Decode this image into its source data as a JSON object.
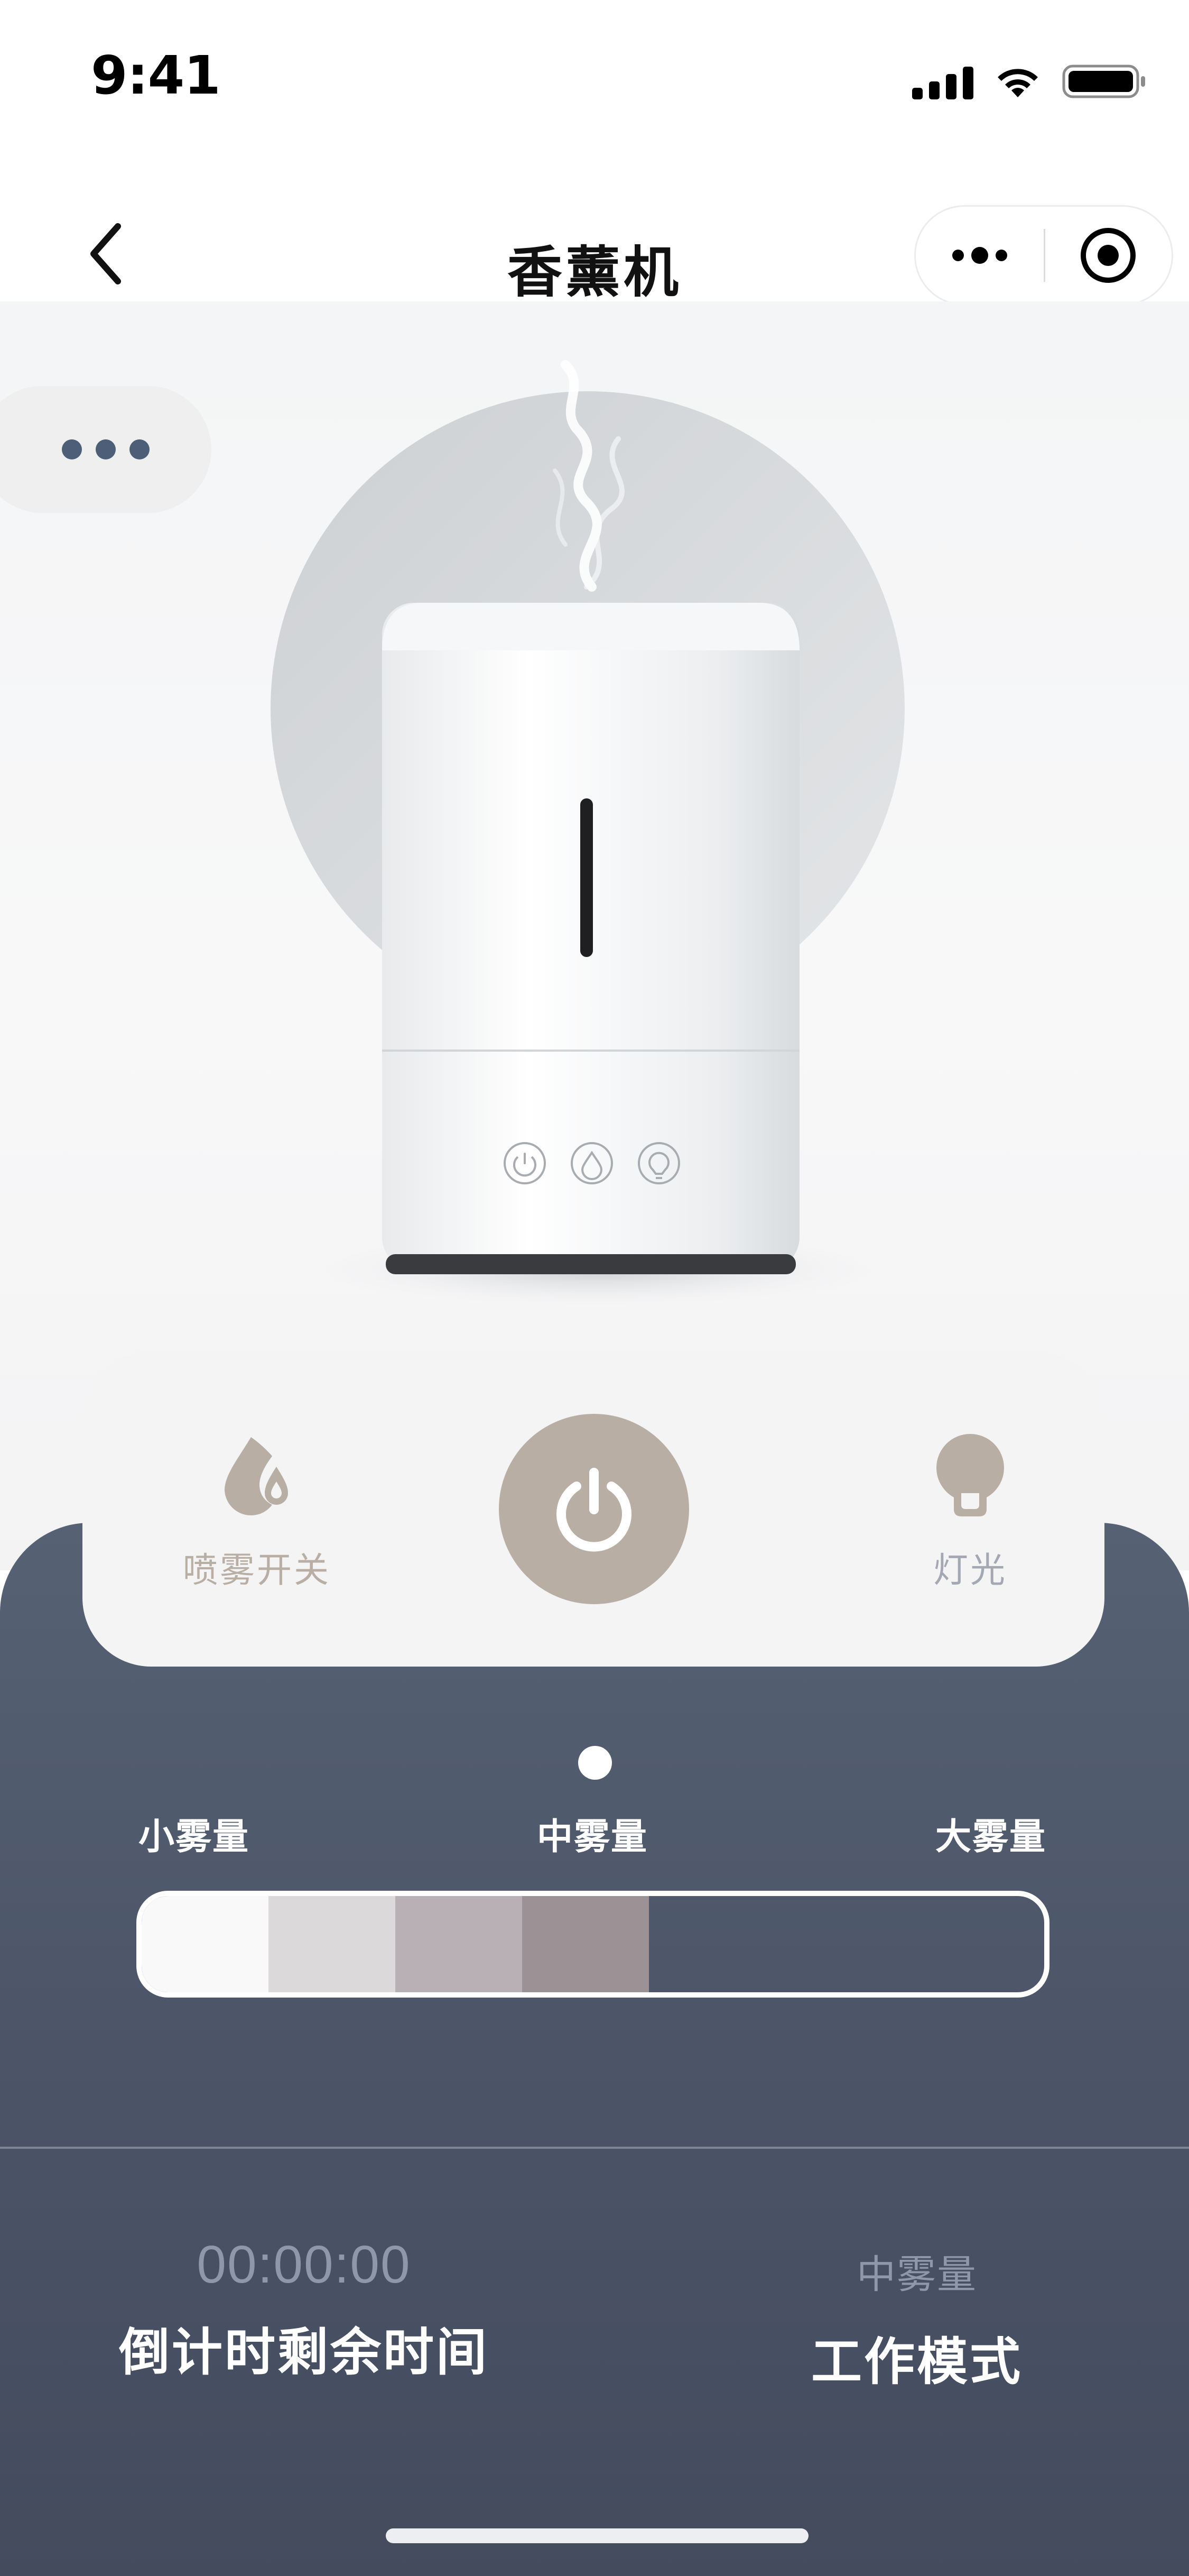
{
  "status_bar": {
    "time": "9:41",
    "icons": [
      "signal-icon",
      "wifi-icon",
      "battery-icon"
    ]
  },
  "nav": {
    "title": "香薰机",
    "back_icon": "chevron-left-icon",
    "capsule_icons": [
      "more-icon",
      "close-target-icon"
    ]
  },
  "hero": {
    "more_icon": "more-dots-icon",
    "device_buttons": [
      "power-icon",
      "drop-icon",
      "bulb-icon"
    ]
  },
  "controls": {
    "spray_label": "喷雾开关",
    "light_label": "灯光",
    "power_icon": "power-icon"
  },
  "mist": {
    "levels": [
      "小雾量",
      "中雾量",
      "大雾量"
    ],
    "current_level": "中雾量",
    "filled_segments": 4,
    "segment_colors": [
      "#f9f9fa",
      "#dcd9db",
      "#b8b0b4",
      "#9c9296"
    ]
  },
  "stats": {
    "countdown_value": "00:00:00",
    "countdown_caption": "倒计时剩余时间",
    "mode_value": "中雾量",
    "mode_caption": "工作模式"
  },
  "colors": {
    "accent": "#b8aea4",
    "panel": "#4f586b",
    "dot_blue": "#4c5e78"
  }
}
